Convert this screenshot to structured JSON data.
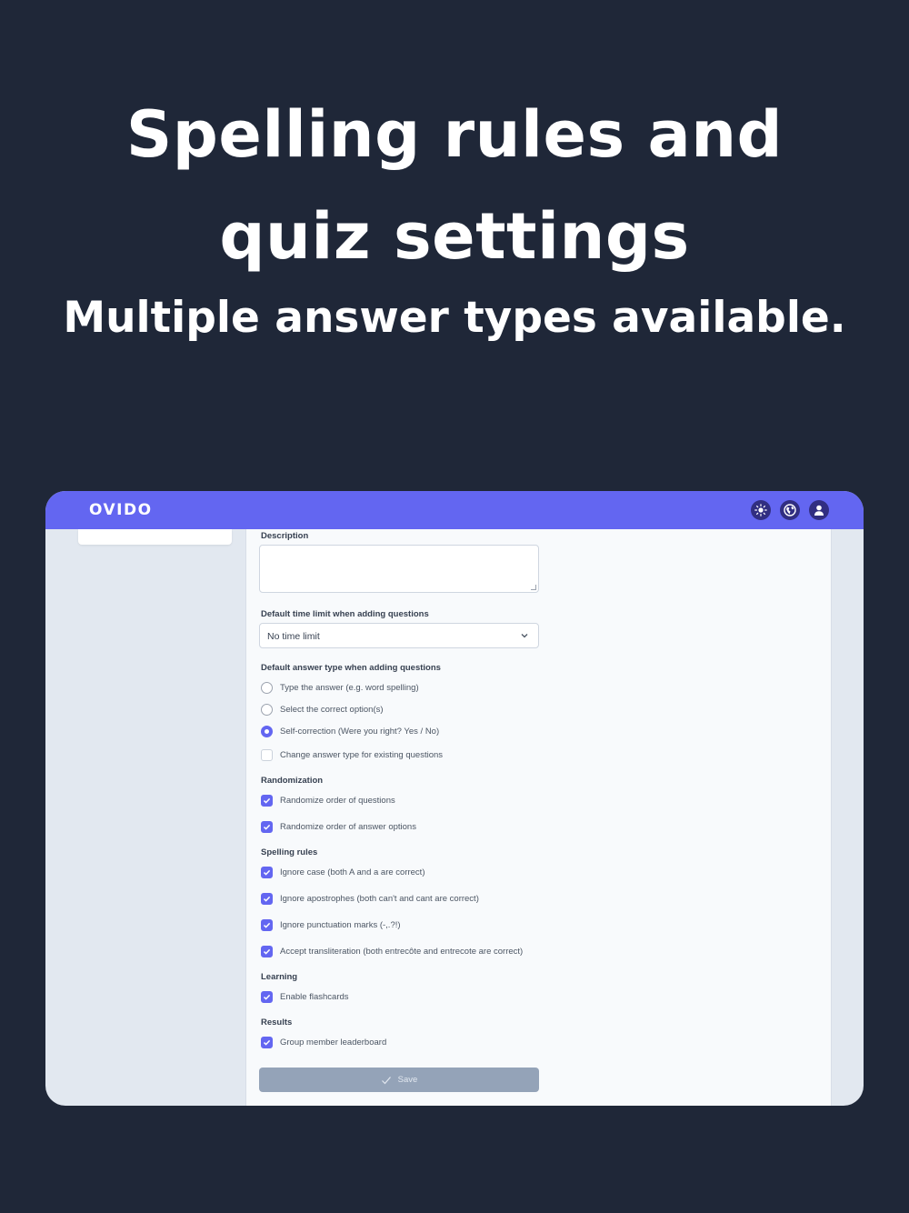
{
  "hero": {
    "title": "Spelling rules and quiz settings",
    "subtitle": "Multiple answer types available."
  },
  "app": {
    "logo": "OVIDO",
    "icons": [
      "sun-icon",
      "globe-icon",
      "user-icon"
    ]
  },
  "form": {
    "description_label": "Description",
    "description_value": "",
    "time_limit_label": "Default time limit when adding questions",
    "time_limit_value": "No time limit",
    "answer_type_label": "Default answer type when adding questions",
    "answer_types": [
      {
        "label": "Type the answer (e.g. word spelling)",
        "selected": false
      },
      {
        "label": "Select the correct option(s)",
        "selected": false
      },
      {
        "label": "Self-correction (Were you right? Yes / No)",
        "selected": true
      }
    ],
    "change_existing_label": "Change answer type for existing questions",
    "change_existing_checked": false,
    "randomization_label": "Randomization",
    "randomization": [
      {
        "label": "Randomize order of questions",
        "checked": true
      },
      {
        "label": "Randomize order of answer options",
        "checked": true
      }
    ],
    "spelling_label": "Spelling rules",
    "spelling": [
      {
        "label": "Ignore case (both A and a are correct)",
        "checked": true
      },
      {
        "label": "Ignore apostrophes (both can't and cant are correct)",
        "checked": true
      },
      {
        "label": "Ignore punctuation marks (-,.?!)",
        "checked": true
      },
      {
        "label": "Accept transliteration (both entrecôte and entrecote are correct)",
        "checked": true
      }
    ],
    "learning_label": "Learning",
    "learning": [
      {
        "label": "Enable flashcards",
        "checked": true
      }
    ],
    "results_label": "Results",
    "results": [
      {
        "label": "Group member leaderboard",
        "checked": true
      }
    ],
    "save_label": "Save"
  },
  "colors": {
    "background": "#1f2738",
    "accent": "#6366f1",
    "save_disabled": "#94a3b8"
  }
}
